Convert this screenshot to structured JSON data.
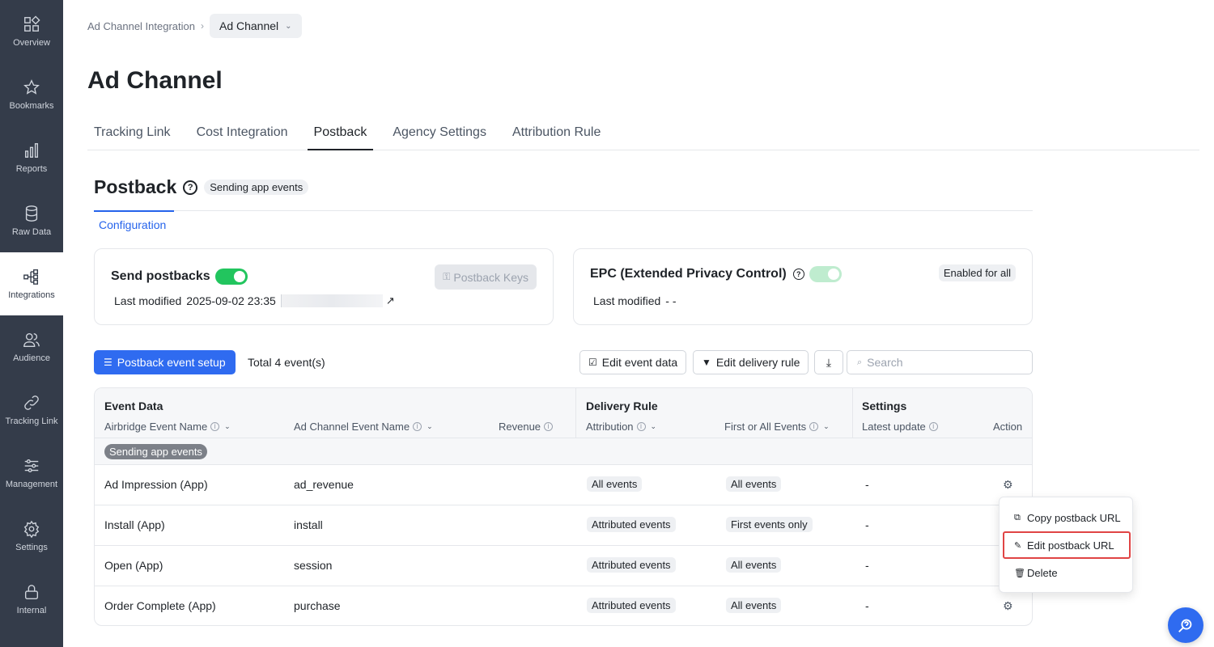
{
  "sidebar": {
    "items": [
      {
        "label": "Overview",
        "icon": "overview-icon"
      },
      {
        "label": "Bookmarks",
        "icon": "star-icon"
      },
      {
        "label": "Reports",
        "icon": "bar-chart-icon"
      },
      {
        "label": "Raw Data",
        "icon": "database-icon"
      },
      {
        "label": "Integrations",
        "icon": "integrations-icon"
      },
      {
        "label": "Audience",
        "icon": "audience-icon"
      },
      {
        "label": "Tracking Link",
        "icon": "link-icon"
      },
      {
        "label": "Management",
        "icon": "sliders-icon"
      },
      {
        "label": "Settings",
        "icon": "gear-icon"
      },
      {
        "label": "Internal",
        "icon": "lock-icon"
      }
    ],
    "active": "Integrations"
  },
  "breadcrumb": {
    "parent": "Ad Channel Integration",
    "current": "Ad Channel"
  },
  "page_title": "Ad Channel",
  "tabs": [
    "Tracking Link",
    "Cost Integration",
    "Postback",
    "Agency Settings",
    "Attribution Rule"
  ],
  "active_tab": "Postback",
  "section": {
    "title": "Postback",
    "badge": "Sending app events",
    "subtab": "Configuration"
  },
  "send_card": {
    "title": "Send postbacks",
    "toggle_on": true,
    "last_modified_label": "Last modified",
    "last_modified_value": "2025-09-02 23:35",
    "keys_button": "Postback Keys"
  },
  "epc_card": {
    "title": "EPC (Extended Privacy Control)",
    "badge": "Enabled for all",
    "last_modified_label": "Last modified",
    "last_modified_value": "- -"
  },
  "toolbar": {
    "setup_button": "Postback event setup",
    "total": "Total 4 event(s)",
    "edit_event_data": "Edit event data",
    "edit_delivery_rule": "Edit delivery rule",
    "search_placeholder": "Search"
  },
  "table": {
    "groups": {
      "event_data": "Event Data",
      "delivery_rule": "Delivery Rule",
      "settings": "Settings"
    },
    "columns": {
      "airbridge": "Airbridge Event Name",
      "channel": "Ad Channel Event Name",
      "revenue": "Revenue",
      "attribution": "Attribution",
      "first_all": "First or All Events",
      "latest": "Latest update",
      "action": "Action"
    },
    "group_label": "Sending app events",
    "rows": [
      {
        "airbridge": "Ad Impression (App)",
        "channel": "ad_revenue",
        "attribution": "All events",
        "first_all": "All events",
        "latest": "-"
      },
      {
        "airbridge": "Install (App)",
        "channel": "install",
        "attribution": "Attributed events",
        "first_all": "First events only",
        "latest": "-"
      },
      {
        "airbridge": "Open (App)",
        "channel": "session",
        "attribution": "Attributed events",
        "first_all": "All events",
        "latest": "-"
      },
      {
        "airbridge": "Order Complete (App)",
        "channel": "purchase",
        "attribution": "Attributed events",
        "first_all": "All events",
        "latest": "-"
      }
    ]
  },
  "action_menu": {
    "items": [
      "Copy postback URL",
      "Edit postback URL",
      "Delete"
    ],
    "highlighted": "Edit postback URL"
  },
  "colors": {
    "sidebar": "#343c4a",
    "primary": "#2f6bf0",
    "toggle": "#22c55e",
    "highlight": "#e04444"
  }
}
